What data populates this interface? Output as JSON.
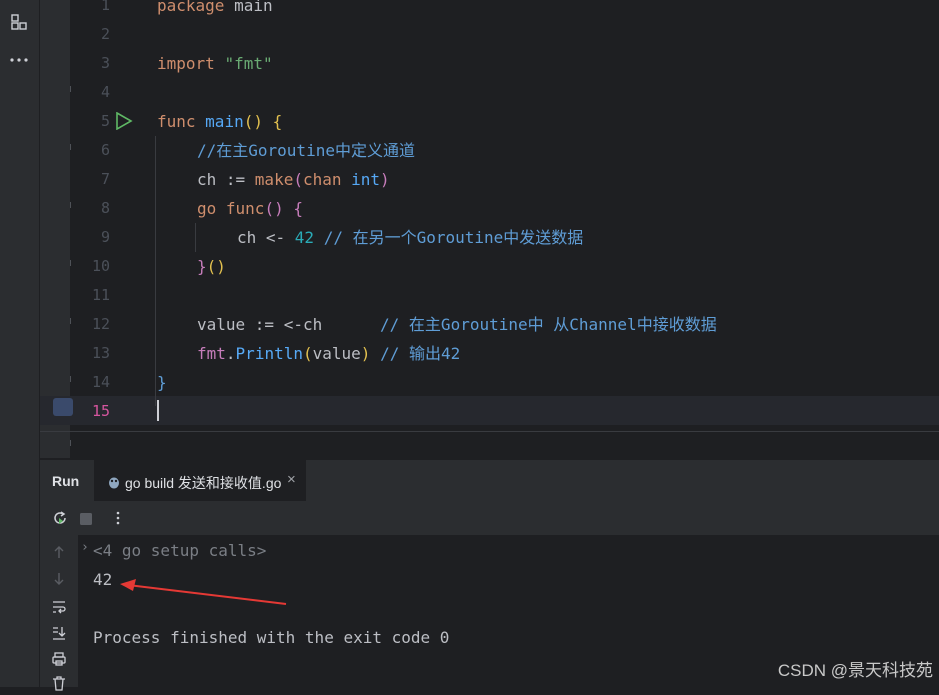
{
  "editor": {
    "line_numbers": [
      "1",
      "2",
      "3",
      "4",
      "5",
      "6",
      "7",
      "8",
      "9",
      "10",
      "11",
      "12",
      "13",
      "14",
      "15"
    ],
    "current_line": "15",
    "code": {
      "l1_kw": "package",
      "l1_name": "main",
      "l3_kw": "import",
      "l3_str": "\"fmt\"",
      "l5_kw": "func",
      "l5_name": "main",
      "l5_parens": "()",
      "l5_brace": "{",
      "l6_comment": "//在主Goroutine中定义通道",
      "l7_var": "ch := ",
      "l7_make": "make",
      "l7_open": "(",
      "l7_chan": "chan",
      "l7_int": " int",
      "l7_close": ")",
      "l8_go": "go",
      "l8_func": "func",
      "l8_parens": "()",
      "l8_brace": "{",
      "l9_send": "ch <- ",
      "l9_num": "42",
      "l9_comment": " // 在另一个Goroutine中发送数据",
      "l10_brace": "}",
      "l10_parens": "()",
      "l12_stmt": "value := <-ch      ",
      "l12_comment": "// 在主Goroutine中 从Channel中接收数据",
      "l13_pkg": "fmt",
      "l13_dot": ".",
      "l13_call": "Println",
      "l13_open": "(",
      "l13_arg": "value",
      "l13_close": ")",
      "l13_comment": " // 输出42",
      "l14_brace": "}"
    }
  },
  "run_panel": {
    "title": "Run",
    "tab_label": "go build 发送和接收值.go",
    "tab_close": "×"
  },
  "console": {
    "setup_calls": "<4 go setup calls>",
    "output": "42",
    "finished": "Process finished with the exit code 0"
  },
  "watermark": "CSDN @景天科技苑",
  "colors": {
    "background": "#1e1f22",
    "panel": "#2b2d30",
    "keyword": "#cf8e6d",
    "comment": "#5f9dd6",
    "string": "#6aab73",
    "number": "#2aacb8",
    "arrow": "#e53935"
  },
  "icons": [
    "structure-icon",
    "more-icon",
    "run-gutter-icon",
    "go-file-icon",
    "rerun-icon",
    "stop-icon",
    "options-icon",
    "scroll-up-icon",
    "scroll-down-icon",
    "soft-wrap-icon",
    "scroll-to-end-icon",
    "print-icon",
    "trash-icon"
  ]
}
